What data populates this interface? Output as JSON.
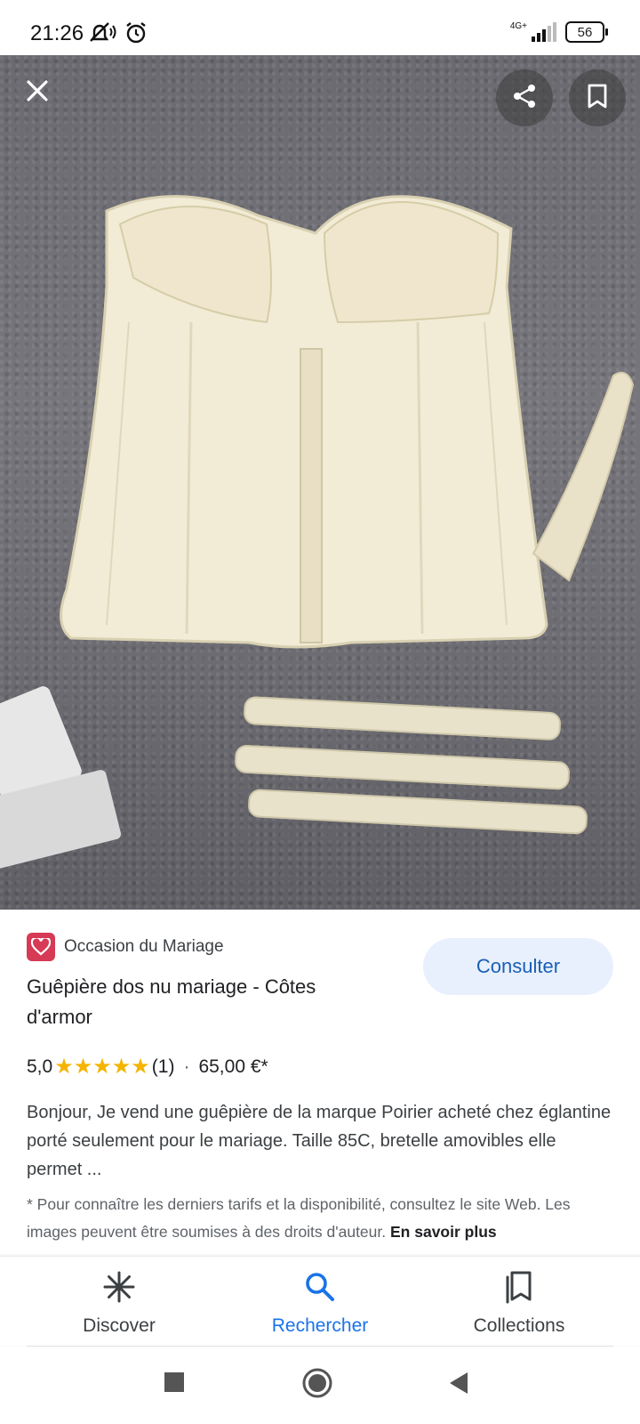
{
  "status_bar": {
    "time": "21:26",
    "network": "4G+",
    "battery": "56"
  },
  "image_viewer": {
    "close_icon": "close-icon",
    "share_icon": "share-icon",
    "bookmark_icon": "bookmark-icon"
  },
  "result": {
    "source_name": "Occasion du Mariage",
    "title": "Guêpière dos nu mariage - Côtes d'armor",
    "consult_label": "Consulter",
    "rating_value": "5,0",
    "stars": "★★★★★",
    "review_count": "(1)",
    "separator": "·",
    "price": "65,00 €*",
    "description": "Bonjour, Je vend une guêpière de la marque Poirier acheté chez églantine porté seulement pour le mariage. Taille 85C, bretelle amovibles elle permet ...",
    "disclaimer": "* Pour connaître les derniers tarifs et la disponibilité, consultez le site Web. Les images peuvent être soumises à des droits d'auteur.",
    "learn_more": "En savoir plus"
  },
  "bottom_nav": {
    "items": [
      {
        "label": "Discover",
        "icon": "asterisk-icon",
        "active": false
      },
      {
        "label": "Rechercher",
        "icon": "search-icon",
        "active": true
      },
      {
        "label": "Collections",
        "icon": "collections-icon",
        "active": false
      }
    ]
  },
  "colors": {
    "accent": "#1a73e8",
    "consult_bg": "#e8f0fe",
    "star": "#f4b400",
    "source_logo": "#d63a55"
  }
}
